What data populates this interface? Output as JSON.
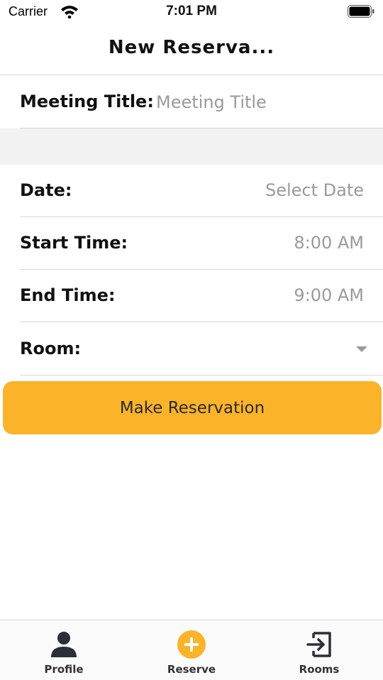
{
  "status_bar": {
    "carrier": "Carrier",
    "time": "7:01 PM"
  },
  "nav": {
    "title": "New Reserva..."
  },
  "form": {
    "meeting_title_label": "Meeting Title:",
    "meeting_title_placeholder": "Meeting Title",
    "date_label": "Date:",
    "date_value": "Select Date",
    "start_time_label": "Start Time:",
    "start_time_value": "8:00 AM",
    "end_time_label": "End Time:",
    "end_time_value": "9:00 AM",
    "room_label": "Room:"
  },
  "actions": {
    "make_reservation": "Make Reservation"
  },
  "tabs": [
    {
      "label": "Profile",
      "icon": "person-icon"
    },
    {
      "label": "Reserve",
      "icon": "plus-circle-icon"
    },
    {
      "label": "Rooms",
      "icon": "enter-icon"
    }
  ],
  "colors": {
    "accent": "#FBB32A",
    "placeholder": "#9A9A9A",
    "separator": "#D8D8D8",
    "section_gap": "#F2F2F2"
  }
}
